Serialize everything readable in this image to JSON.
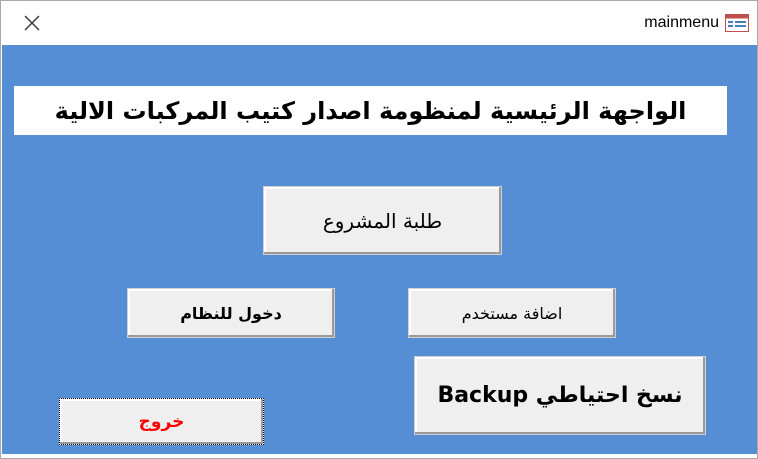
{
  "window": {
    "title": "mainmenu"
  },
  "main": {
    "heading": "الواجهة الرئيسية لمنظومة اصدار كتيب المركبات الالية",
    "buttons": {
      "students": "طلبة المشروع",
      "login": "دخول للنظام",
      "add_user": "اضافة مستخدم",
      "backup": "نسخ احتياطي Backup",
      "exit": "خروج"
    }
  },
  "colors": {
    "form_background": "#558ed5",
    "button_face": "#efefef",
    "exit_text": "#ff0000"
  },
  "icons": {
    "close": "close-icon",
    "form": "form-icon"
  }
}
